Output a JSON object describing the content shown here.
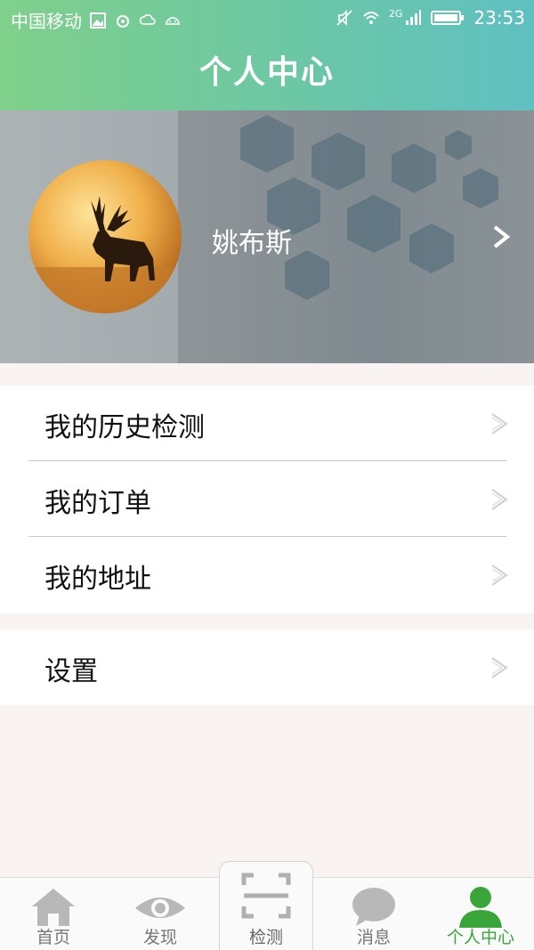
{
  "status_bar": {
    "carrier": "中国移动",
    "network": "2G",
    "time": "23:53"
  },
  "header": {
    "title": "个人中心"
  },
  "profile": {
    "username": "姚布斯"
  },
  "menu": {
    "group1": [
      {
        "label": "我的历史检测"
      },
      {
        "label": "我的订单"
      },
      {
        "label": "我的地址"
      }
    ],
    "group2": [
      {
        "label": "设置"
      }
    ]
  },
  "tabbar": {
    "tabs": [
      {
        "label": "首页",
        "icon": "home-icon"
      },
      {
        "label": "发现",
        "icon": "eye-icon"
      },
      {
        "label": "检测",
        "icon": "scan-icon"
      },
      {
        "label": "消息",
        "icon": "message-icon"
      },
      {
        "label": "个人中心",
        "icon": "person-icon"
      }
    ],
    "active_color": "#3aa63a",
    "inactive_color": "#777777"
  },
  "colors": {
    "header_gradient_start": "#7fd08a",
    "header_gradient_end": "#5fc0c2",
    "page_background": "#f9f4f1"
  }
}
